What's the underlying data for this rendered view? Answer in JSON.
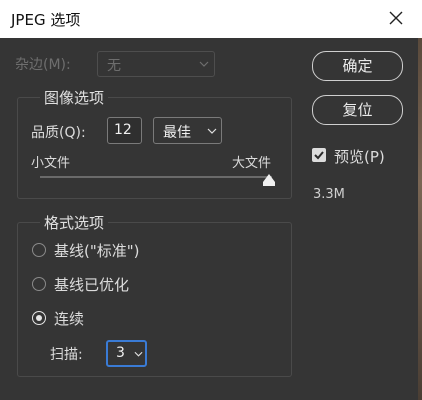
{
  "window": {
    "title": "JPEG 选项"
  },
  "matte": {
    "label": "杂边(M):",
    "value": "无"
  },
  "image_options": {
    "title": "图像选项",
    "quality_label": "品质(Q):",
    "quality_value": "12",
    "quality_preset": "最佳",
    "small_file": "小文件",
    "large_file": "大文件",
    "quality_level": 1.0
  },
  "format_options": {
    "title": "格式选项",
    "radios": [
      {
        "label": "基线(\"标准\")",
        "checked": false
      },
      {
        "label": "基线已优化",
        "checked": false
      },
      {
        "label": "连续",
        "checked": true
      }
    ],
    "scans_label": "扫描:",
    "scans_value": "3"
  },
  "buttons": {
    "ok": "确定",
    "reset": "复位"
  },
  "preview": {
    "label": "预览(P)",
    "checked": true,
    "file_size": "3.3M"
  },
  "colors": {
    "dialog_bg": "#353535",
    "focus_border": "#3a7bd5"
  }
}
